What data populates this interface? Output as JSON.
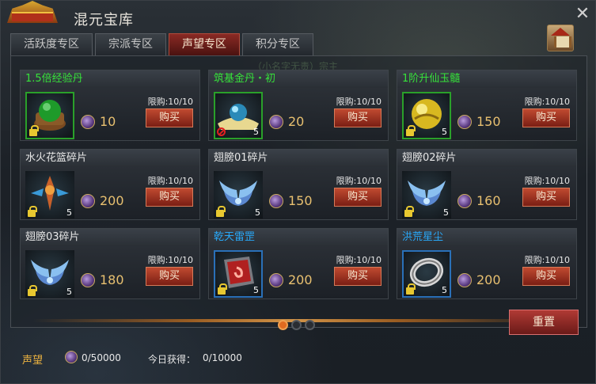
{
  "window": {
    "title": "混元宝库",
    "close_symbol": "✕"
  },
  "tabs": [
    {
      "label": "活跃度专区",
      "active": false
    },
    {
      "label": "宗派专区",
      "active": false
    },
    {
      "label": "声望专区",
      "active": true
    },
    {
      "label": "积分专区",
      "active": false
    }
  ],
  "ghost_text": "（小名字无责）宗主",
  "shop": {
    "limit_prefix": "限购:",
    "buy_label": "购买",
    "items": [
      {
        "name": "1.5倍经验丹",
        "name_color": "green",
        "price": "10",
        "limit": "10/10",
        "count": "",
        "icon": "green-orb-cauldron-icon",
        "border": "green",
        "lock": "lock",
        "color": "#36e23a"
      },
      {
        "name": "筑基金丹・初",
        "name_color": "green",
        "price": "20",
        "limit": "10/10",
        "count": "5",
        "icon": "blue-pill-icon",
        "border": "green",
        "lock": "forbidden",
        "color": "#36e23a"
      },
      {
        "name": "1阶升仙玉髓",
        "name_color": "green",
        "price": "150",
        "limit": "10/10",
        "count": "5",
        "icon": "gold-jade-icon",
        "border": "green",
        "lock": "lock",
        "color": "#36e23a"
      },
      {
        "name": "水火花篮碎片",
        "name_color": "white",
        "price": "200",
        "limit": "10/10",
        "count": "5",
        "icon": "flower-basket-icon",
        "border": "none",
        "lock": "lock",
        "color": "#e8e8e8"
      },
      {
        "name": "翅膀01碎片",
        "name_color": "white",
        "price": "150",
        "limit": "10/10",
        "count": "5",
        "icon": "wings-icon",
        "border": "none",
        "lock": "lock",
        "color": "#e8e8e8"
      },
      {
        "name": "翅膀02碎片",
        "name_color": "white",
        "price": "160",
        "limit": "10/10",
        "count": "5",
        "icon": "wings-icon",
        "border": "none",
        "lock": "lock",
        "color": "#e8e8e8"
      },
      {
        "name": "翅膀03碎片",
        "name_color": "white",
        "price": "180",
        "limit": "10/10",
        "count": "5",
        "icon": "wings-icon",
        "border": "none",
        "lock": "lock",
        "color": "#e8e8e8"
      },
      {
        "name": "乾天雷罡",
        "name_color": "blue",
        "price": "200",
        "limit": "10/10",
        "count": "5",
        "icon": "red-shield-icon",
        "border": "blue",
        "lock": "lock",
        "color": "#28a8f8"
      },
      {
        "name": "洪荒星尘",
        "name_color": "blue",
        "price": "200",
        "limit": "10/10",
        "count": "5",
        "icon": "silver-ring-icon",
        "border": "blue",
        "lock": "lock",
        "color": "#28a8f8"
      }
    ]
  },
  "pagination": {
    "pages": 3,
    "current": 1
  },
  "reset_label": "重置",
  "footer": {
    "reputation_label": "声望",
    "reputation_value": "0/50000",
    "today_label": "今日获得：",
    "today_value": "0/10000"
  }
}
